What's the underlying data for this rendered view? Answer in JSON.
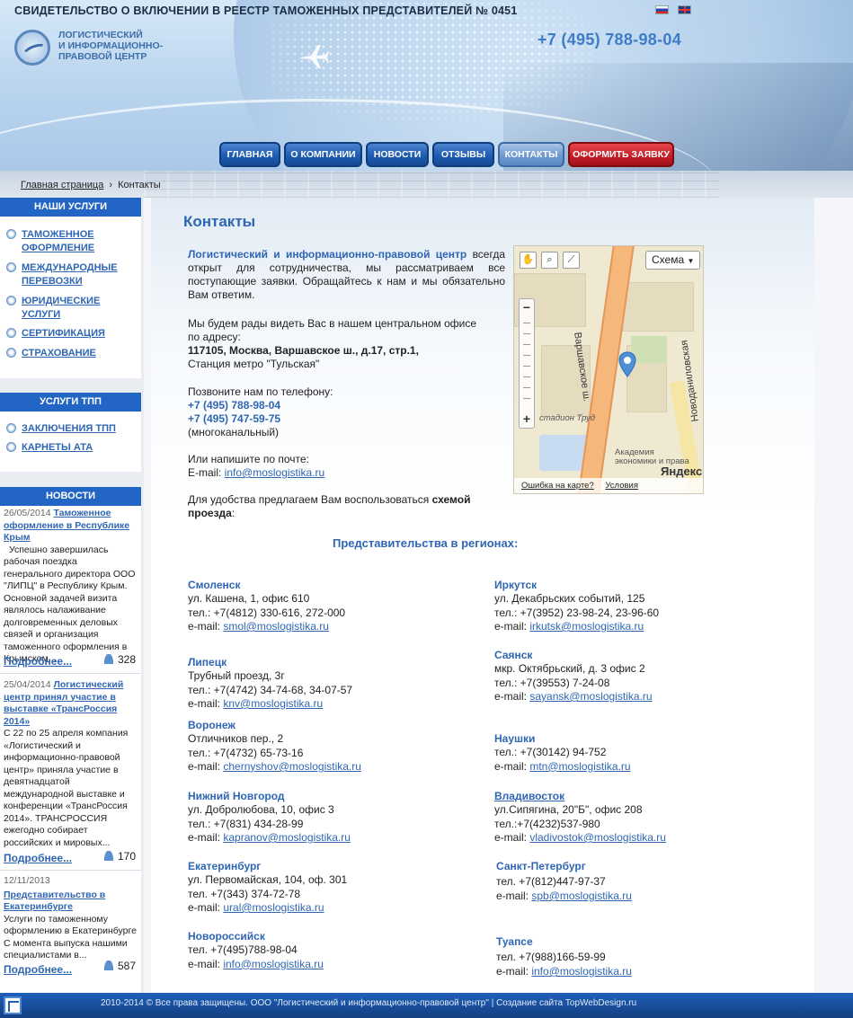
{
  "header": {
    "certificate": "СВИДЕТЕЛЬСТВО О ВКЛЮЧЕНИИ В РЕЕСТР ТАМОЖЕННЫХ ПРЕДСТАВИТЕЛЕЙ № 0451",
    "logo_lines": [
      "Логистический",
      "и информационно-",
      "правовой центр"
    ],
    "phone": "+7 (495) 788-98-04"
  },
  "nav": [
    "ГЛАВНАЯ",
    "О КОМПАНИИ",
    "НОВОСТИ",
    "ОТЗЫВЫ",
    "КОНТАКТЫ",
    "ОФОРМИТЬ ЗАЯВКУ"
  ],
  "breadcrumb": {
    "home": "Главная страница",
    "sep": "›",
    "current": "Контакты"
  },
  "sidebar": {
    "services_title": "НАШИ УСЛУГИ",
    "services": [
      "ТАМОЖЕННОЕ ОФОРМЛЕНИЕ",
      "МЕЖДУНАРОДНЫЕ ПЕРЕВОЗКИ",
      "ЮРИДИЧЕСКИЕ УСЛУГИ",
      "СЕРТИФИКАЦИЯ",
      "СТРАХОВАНИЕ"
    ],
    "tpp_title": "УСЛУГИ ТПП",
    "tpp": [
      "ЗАКЛЮЧЕНИЯ ТПП",
      "КАРНЕТЫ АТА"
    ],
    "news_title": "НОВОСТИ",
    "news": [
      {
        "date": "26/05/2014",
        "title": "Таможенное оформление в Республике Крым",
        "text": "Успешно завершилась рабочая поездка генерального директора ООО \"ЛИПЦ\" в Республику Крым. Основной задачей визита являлось налаживание долговременных деловых связей и организация таможенного оформления в Крымском...",
        "more": "Подробнее...",
        "count": "328"
      },
      {
        "date": "25/04/2014",
        "title": "Логистический центр принял участие в выставке «ТрансРоссия 2014»",
        "text": "С 22 по 25 апреля компания «Логистический и информационно-правовой центр» приняла участие в девятнадцатой международной выставке и конференции «ТрансРоссия 2014». ТРАНСРОССИЯ ежегодно собирает российских и мировых...",
        "more": "Подробнее...",
        "count": "170"
      },
      {
        "date": "12/11/2013",
        "title": "Представительство в Екатеринбурге",
        "text": "Услуги по таможенному оформлению в Екатеринбурге С момента выпуска нашими специалистами в...",
        "more": "Подробнее...",
        "count": "587"
      }
    ]
  },
  "content": {
    "title": "Контакты",
    "intro_company": "Логистический и информационно-правовой центр",
    "intro_rest": " всегда открыт для сотрудничества, мы рассматриваем все поступающие заявки. Обращайтесь к нам и мы обязательно Вам ответим.",
    "office_intro": "Мы будем рады видеть Вас в нашем центральном офисе по адресу:",
    "address": "117105, Москва, Варшавское ш., д.17, стр.1,",
    "metro": "Станция метро \"Тульская\"",
    "call_intro": "Позвоните нам по телефону:",
    "phone1": "+7 (495) 788-98-04",
    "phone2": "+7 (495) 747-59-75",
    "multichannel": "(многоканальный)",
    "mail_intro": "Или напишите по почте:",
    "email_label": "E-mail: ",
    "email": "info@moslogistika.ru",
    "scheme_pre": "Для удобства предлагаем Вам  воспользоваться ",
    "scheme_bold": "схемой проезда",
    "scheme_post": ":",
    "regions_title": "Представительства в регионах:"
  },
  "map": {
    "scheme_label": "Схема",
    "road_left": "Варшавское ш.",
    "road_right": "Новоданиловская",
    "stadium": "стадион Труд",
    "academy_line1": "Академия",
    "academy_line2": "экономики и права",
    "brand": "Яндекс",
    "error_link": "Ошибка на карте?",
    "terms_link": "Условия использования"
  },
  "offices_left": [
    {
      "city": "Смоленск",
      "lines": [
        "ул. Кашена, 1, офис 610",
        "тел.: +7(4812) 330-616, 272-000"
      ],
      "email": "smol@moslogistika.ru"
    },
    {
      "city": "Липецк",
      "lines": [
        "Трубный проезд, 3г",
        "тел.: +7(4742) 34-74-68, 34-07-57"
      ],
      "email": "knv@moslogistika.ru"
    },
    {
      "city": "Воронеж",
      "lines": [
        "Отличников пер., 2",
        "тел.: +7(4732) 65-73-16"
      ],
      "email": "chernyshov@moslogistika.ru"
    },
    {
      "city": "Нижний Новгород",
      "lines": [
        "ул. Добролюбова, 10, офис 3",
        "тел.: +7(831) 434-28-99"
      ],
      "email": "kapranov@moslogistika.ru"
    },
    {
      "city": "Екатеринбург",
      "lines": [
        "ул. Первомайская, 104, оф. 301",
        "тел. +7(343) 374-72-78"
      ],
      "email": "ural@moslogistika.ru"
    },
    {
      "city": "Новороссийск",
      "lines": [
        "тел. +7(495)788-98-04"
      ],
      "email": "info@moslogistika.ru"
    }
  ],
  "offices_right": [
    {
      "city": "Иркутск",
      "lines": [
        "ул. Декабрьских событий, 125",
        "тел.: +7(3952) 23-98-24, 23-96-60"
      ],
      "email": "irkutsk@moslogistika.ru"
    },
    {
      "city": "Саянск",
      "lines": [
        "мкр. Октябрьский, д. 3 офис 2",
        "тел.: +7(39553) 7-24-08"
      ],
      "email": "sayansk@moslogistika.ru"
    },
    {
      "city": "Наушки",
      "lines": [
        "тел.: +7(30142) 94-752"
      ],
      "email": "mtn@moslogistika.ru"
    },
    {
      "city": "Владивосток",
      "lines": [
        "ул.Сипягина, 20\"Б\", офис 208",
        "тел.:+7(4232)537-980"
      ],
      "email": "vladivostok@moslogistika.ru"
    },
    {
      "city": "Санкт-Петербург",
      "lines": [
        "тел. +7(812)447-97-37"
      ],
      "email": "spb@moslogistika.ru"
    },
    {
      "city": "Туапсе",
      "lines": [
        "тел. +7(988)166-59-99"
      ],
      "email": "info@moslogistika.ru"
    }
  ],
  "email_label": "e-mail: ",
  "footer": "2010-2014 © Все права защищены. ООО \"Логистический и информационно-правовой центр\"  |  Создание сайта TopWebDesign.ru"
}
